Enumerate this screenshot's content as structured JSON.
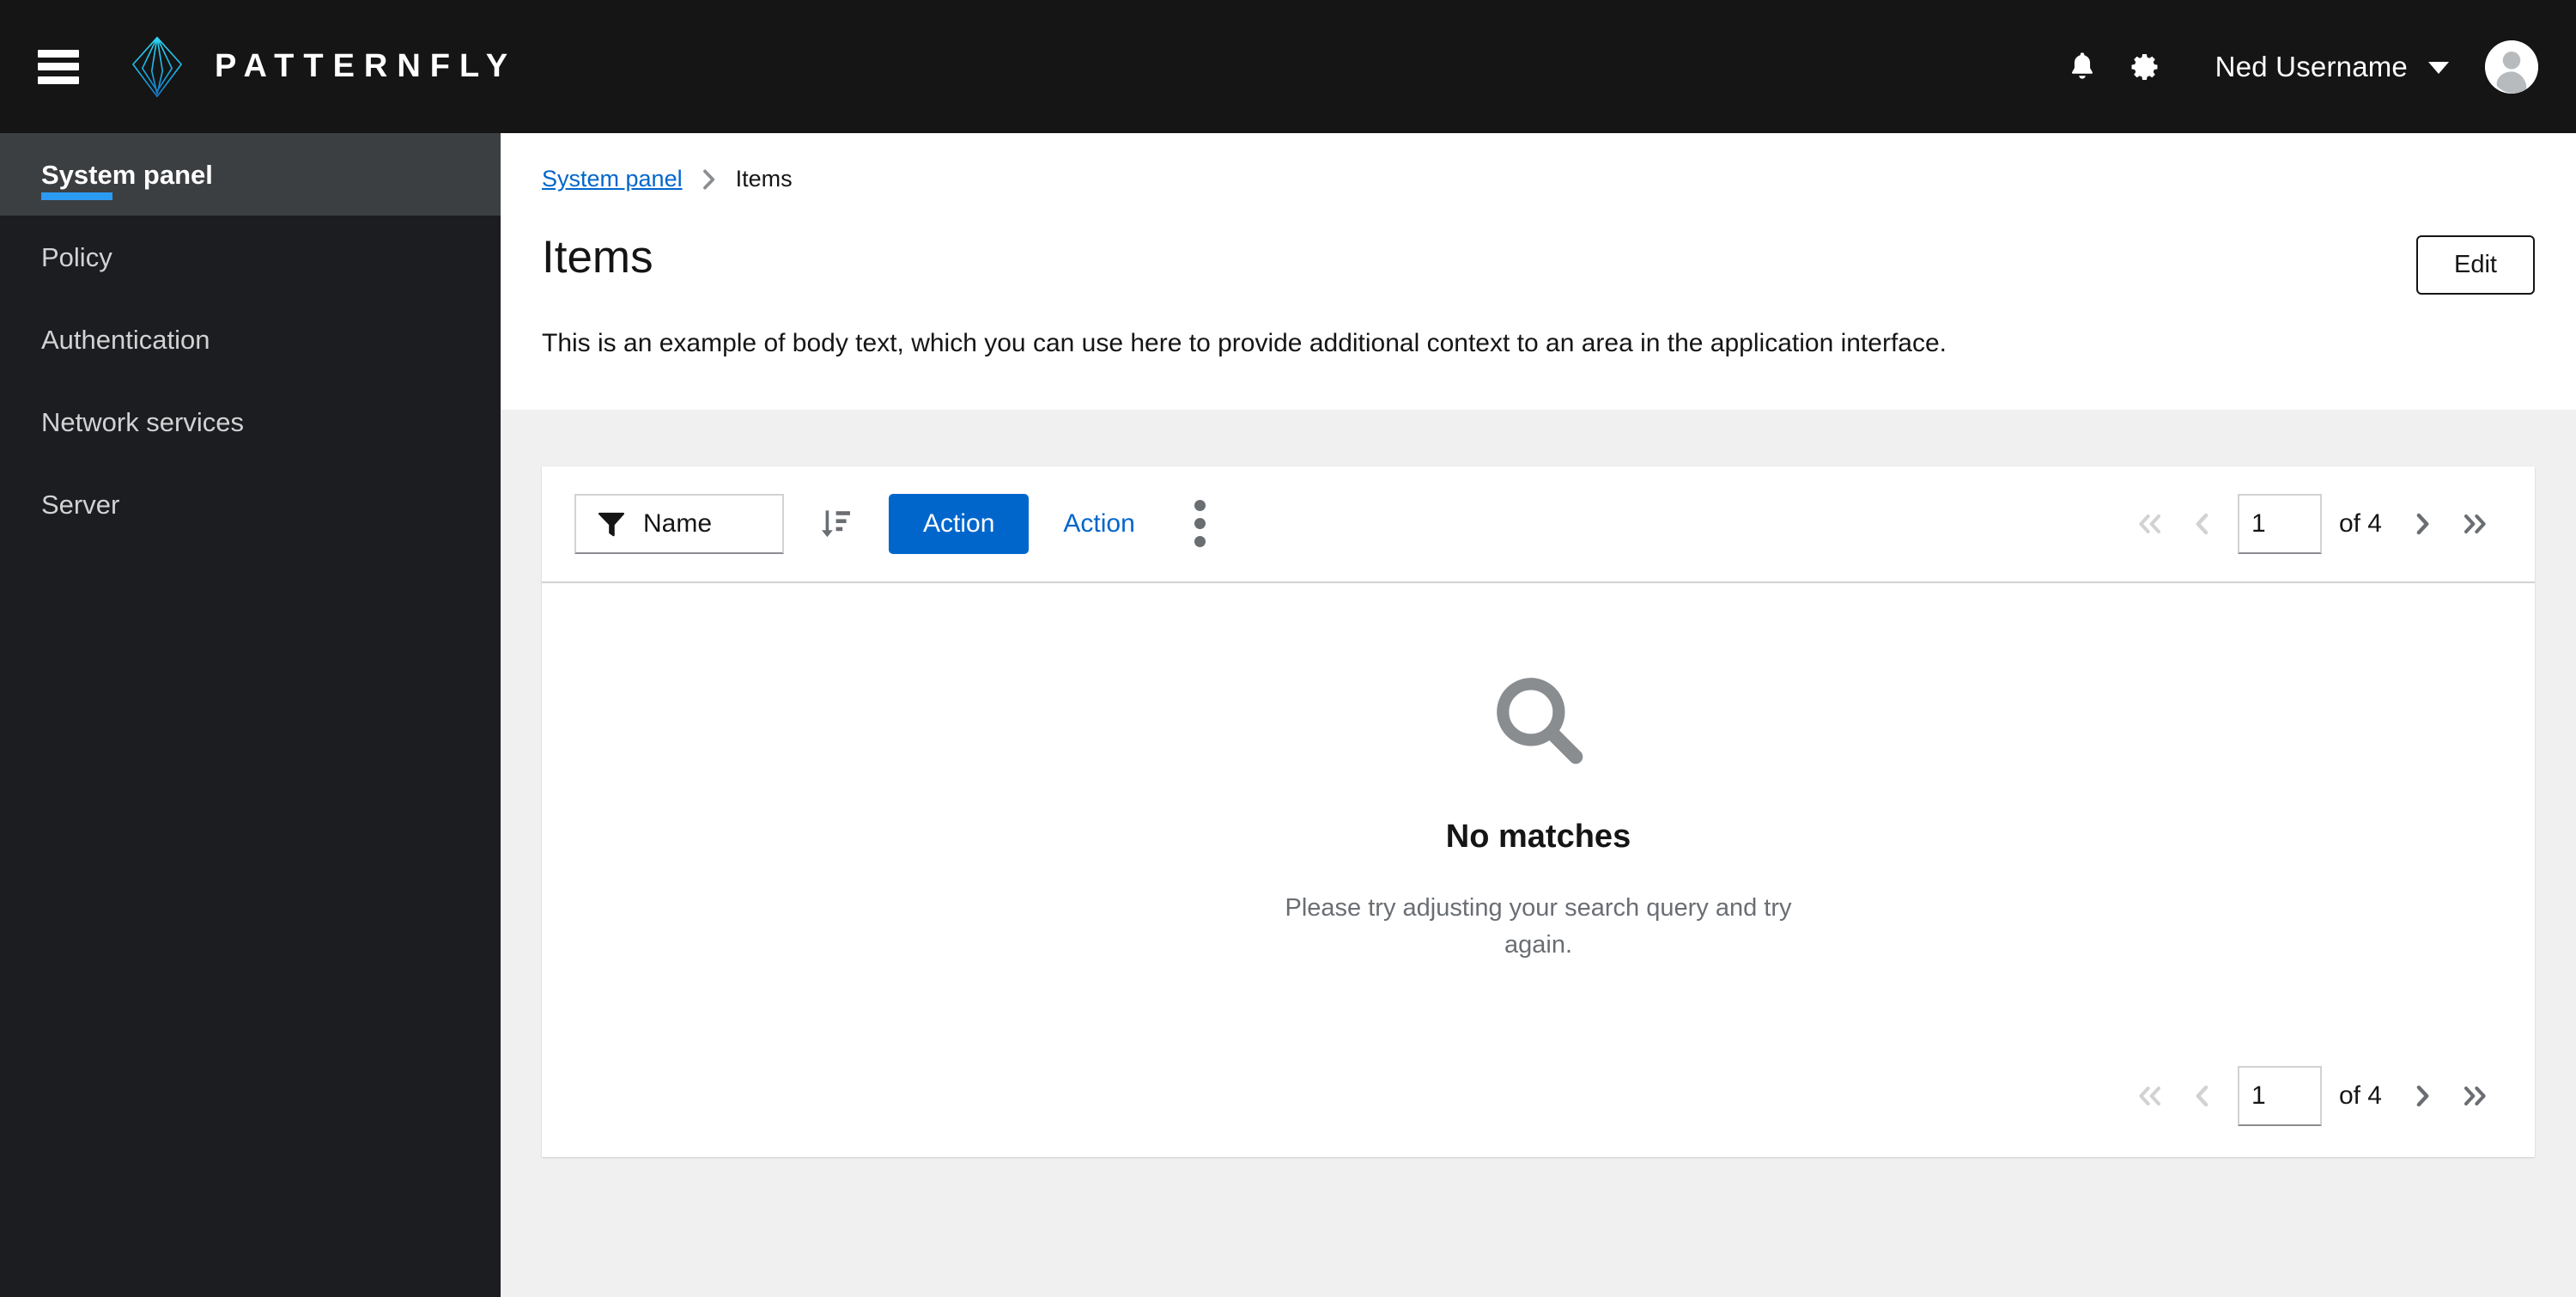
{
  "masthead": {
    "toggle_label": "Global navigation toggle",
    "brand_name": "PATTERNFLY",
    "notifications_label": "Notifications",
    "settings_label": "Settings",
    "user_name": "Ned Username",
    "avatar_label": "User avatar"
  },
  "sidebar": {
    "items": [
      {
        "label": "System panel",
        "active": true
      },
      {
        "label": "Policy",
        "active": false
      },
      {
        "label": "Authentication",
        "active": false
      },
      {
        "label": "Network services",
        "active": false
      },
      {
        "label": "Server",
        "active": false
      }
    ]
  },
  "breadcrumb": {
    "parent": "System panel",
    "separator": "›",
    "current": "Items"
  },
  "page": {
    "title": "Items",
    "edit_label": "Edit",
    "body_text": "This is an example of body text, which you can use here to provide additional context to an area in the application interface."
  },
  "toolbar": {
    "filter_label": "Name",
    "sort_label": "Sort",
    "action_primary_label": "Action",
    "action_secondary_label": "Action",
    "kebab_label": "More actions"
  },
  "pagination": {
    "first_label": "Go to first page",
    "previous_label": "Go to previous page",
    "page_value": "1",
    "of_text": "of 4",
    "next_label": "Go to next page",
    "last_label": "Go to last page",
    "first_disabled": true,
    "previous_disabled": true
  },
  "empty_state": {
    "icon": "search-icon",
    "title": "No matches",
    "body": "Please try adjusting your search query and try again."
  },
  "colors": {
    "masthead_bg": "#151515",
    "sidebar_bg": "#1b1d21",
    "sidebar_active_bg": "#3c3f42",
    "accent_blue": "#2b9af3",
    "link_blue": "#0066cc",
    "page_bg": "#f0f0f0",
    "muted_text": "#6a6e73",
    "icon_gray": "#8a8d90"
  }
}
